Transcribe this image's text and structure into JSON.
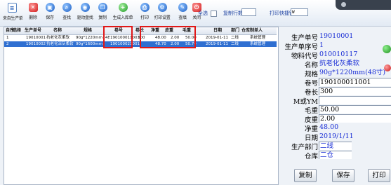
{
  "toolbar": {
    "buttons": [
      {
        "label": "来自生产单",
        "icon": "doc-icon"
      },
      {
        "label": "删除",
        "icon": "delete-icon"
      },
      {
        "label": "保存",
        "icon": "save-icon"
      },
      {
        "label": "查找",
        "icon": "search-icon"
      },
      {
        "label": "驱动盘找",
        "icon": "drive-icon"
      },
      {
        "label": "复制",
        "icon": "copy-icon"
      },
      {
        "label": "生成入库单",
        "icon": "storage-icon"
      },
      {
        "label": "打印",
        "icon": "print-icon"
      },
      {
        "label": "打印设置",
        "icon": "print-settings-icon"
      },
      {
        "label": "查填",
        "icon": "fill-icon"
      },
      {
        "label": "关闭",
        "icon": "close-icon"
      }
    ],
    "select_all_label": "全选",
    "copy_count_label": "复制行数：",
    "copy_count_value": "",
    "print_template_label": "打印快捷键：",
    "print_template_value": "W"
  },
  "grid": {
    "columns": [
      "自序",
      "选择",
      "生产单号",
      "名称",
      "规格",
      "卷号",
      "卷长",
      "净重",
      "皮重",
      "毛重",
      "",
      "日期",
      "部门",
      "仓库",
      "制单人"
    ],
    "rows": [
      {
        "seq": "1",
        "order_no": "19010001",
        "name": "抗老化灰柔软",
        "spec": "90g*1220mm (48寸)",
        "roll_no": "190100011001",
        "length": "300",
        "net": "48.00",
        "tare": "2.00",
        "gross": "50.00",
        "date": "2019-01-11",
        "dept": "二线",
        "warehouse": "",
        "maker": "系统管理"
      },
      {
        "seq": "2",
        "order_no": "19010002",
        "name": "抗老化深灰柔软",
        "spec": "90g*1600mm",
        "roll_no": "190100021001",
        "length": "",
        "net": "48.70",
        "tare": "2.00",
        "gross": "50.70",
        "date": "2019-01-11",
        "dept": "二线",
        "warehouse": "",
        "maker": "系统管理"
      }
    ]
  },
  "panel": {
    "fields": [
      {
        "label": "生产单号",
        "value": "19010001",
        "color": "blue",
        "boxed": false
      },
      {
        "label": "生产单序号",
        "value": "1",
        "color": "blue",
        "boxed": false
      },
      {
        "label": "物料代号",
        "value": "010010117",
        "color": "blue",
        "boxed": false
      },
      {
        "label": "名称",
        "value": "抗老化灰柔软",
        "color": "blue",
        "boxed": false
      },
      {
        "label": "规格",
        "value": "90g*1220mm(48寸)",
        "color": "blue",
        "boxed": false
      },
      {
        "label": "卷号",
        "value": "190100011001",
        "color": "black",
        "boxed": true
      },
      {
        "label": "卷长",
        "value": "300",
        "color": "black",
        "boxed": true
      },
      {
        "label": "M或YM",
        "value": "",
        "color": "black",
        "boxed": true
      },
      {
        "label": "毛重",
        "value": "50.00",
        "color": "black",
        "boxed": true
      },
      {
        "label": "皮重",
        "value": "2.00",
        "color": "black",
        "boxed": true
      },
      {
        "label": "净重",
        "value": "48.00",
        "color": "blue",
        "boxed": false
      },
      {
        "label": "日期",
        "value": "2019/1/11",
        "color": "blue",
        "boxed": false
      },
      {
        "label": "生产部门",
        "value": "二线",
        "color": "blue",
        "boxed": true
      },
      {
        "label": "仓库",
        "value": "二仓",
        "color": "blue",
        "boxed": true
      }
    ],
    "buttons": {
      "copy": "复制",
      "save": "保存",
      "print": "打印"
    }
  }
}
